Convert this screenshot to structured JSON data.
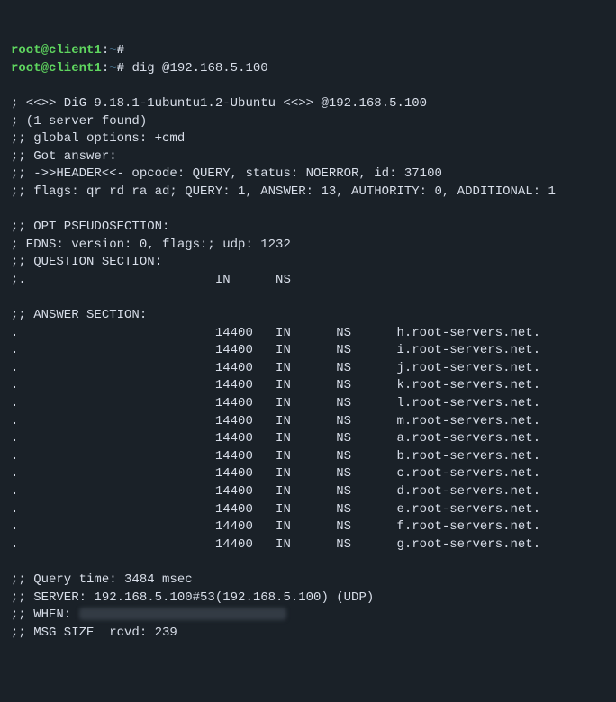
{
  "prompt1": {
    "user": "root@client1",
    "sep": ":",
    "cwd": "~",
    "sym": "#",
    "cmd": ""
  },
  "prompt2": {
    "user": "root@client1",
    "sep": ":",
    "cwd": "~",
    "sym": "#",
    "cmd": " dig @192.168.5.100"
  },
  "header": {
    "l1": "; <<>> DiG 9.18.1-1ubuntu1.2-Ubuntu <<>> @192.168.5.100",
    "l2": "; (1 server found)",
    "l3": ";; global options: +cmd",
    "l4": ";; Got answer:",
    "l5": ";; ->>HEADER<<- opcode: QUERY, status: NOERROR, id: 37100",
    "l6": ";; flags: qr rd ra ad; QUERY: 1, ANSWER: 13, AUTHORITY: 0, ADDITIONAL: 1"
  },
  "opt": {
    "l1": ";; OPT PSEUDOSECTION:",
    "l2": "; EDNS: version: 0, flags:; udp: 1232",
    "l3": ";; QUESTION SECTION:",
    "l4": ";.                         IN      NS"
  },
  "ans_header": ";; ANSWER SECTION:",
  "answers": [
    {
      "name": ".",
      "ttl": "14400",
      "cls": "IN",
      "type": "NS",
      "data": "h.root-servers.net."
    },
    {
      "name": ".",
      "ttl": "14400",
      "cls": "IN",
      "type": "NS",
      "data": "i.root-servers.net."
    },
    {
      "name": ".",
      "ttl": "14400",
      "cls": "IN",
      "type": "NS",
      "data": "j.root-servers.net."
    },
    {
      "name": ".",
      "ttl": "14400",
      "cls": "IN",
      "type": "NS",
      "data": "k.root-servers.net."
    },
    {
      "name": ".",
      "ttl": "14400",
      "cls": "IN",
      "type": "NS",
      "data": "l.root-servers.net."
    },
    {
      "name": ".",
      "ttl": "14400",
      "cls": "IN",
      "type": "NS",
      "data": "m.root-servers.net."
    },
    {
      "name": ".",
      "ttl": "14400",
      "cls": "IN",
      "type": "NS",
      "data": "a.root-servers.net."
    },
    {
      "name": ".",
      "ttl": "14400",
      "cls": "IN",
      "type": "NS",
      "data": "b.root-servers.net."
    },
    {
      "name": ".",
      "ttl": "14400",
      "cls": "IN",
      "type": "NS",
      "data": "c.root-servers.net."
    },
    {
      "name": ".",
      "ttl": "14400",
      "cls": "IN",
      "type": "NS",
      "data": "d.root-servers.net."
    },
    {
      "name": ".",
      "ttl": "14400",
      "cls": "IN",
      "type": "NS",
      "data": "e.root-servers.net."
    },
    {
      "name": ".",
      "ttl": "14400",
      "cls": "IN",
      "type": "NS",
      "data": "f.root-servers.net."
    },
    {
      "name": ".",
      "ttl": "14400",
      "cls": "IN",
      "type": "NS",
      "data": "g.root-servers.net."
    }
  ],
  "footer": {
    "qt": ";; Query time: 3484 msec",
    "srv": ";; SERVER: 192.168.5.100#53(192.168.5.100) (UDP)",
    "when_pre": ";; WHEN: ",
    "msg": ";; MSG SIZE  rcvd: 239"
  }
}
